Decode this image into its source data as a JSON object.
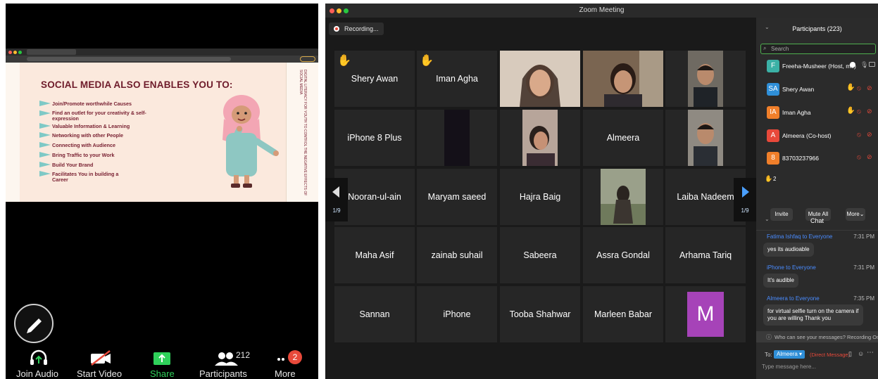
{
  "phone": {
    "slide": {
      "title": "SOCIAL MEDIA ALSO ENABLES YOU TO:",
      "items": [
        "Join/Promote worthwhile Causes",
        "Find an outlet for your creativity & self-expression",
        "Valuable Information & Learning",
        "Networking with other People",
        "Connecting with Audience",
        "Bring Traffic to your Work",
        "Build Your Brand",
        "Facilitates You in building a Career"
      ],
      "side_text": "DIGITAL LITERACY FOR YOUTH TO CONTROL THE NEGATIVE EFFECTS OF SOCIAL MEDIA"
    },
    "toolbar": {
      "join_audio": "Join Audio",
      "start_video": "Start Video",
      "share": "Share",
      "participants": "Participants",
      "participants_count": "212",
      "more": "More",
      "more_badge": "2"
    }
  },
  "zoom": {
    "window_title": "Zoom Meeting",
    "recording": "Recording...",
    "page_indicator": "1/9",
    "grid": [
      [
        "Shery Awan",
        "Iman Agha",
        "",
        "",
        ""
      ],
      [
        "iPhone 8 Plus",
        "",
        "",
        "Almeera",
        ""
      ],
      [
        "Nooran-ul-ain",
        "Maryam saeed",
        "Hajra Baig",
        "",
        "Laiba Nadeem"
      ],
      [
        "Maha Asif",
        "zainab suhail",
        "Sabeera",
        "Assra Gondal",
        "Arhama Tariq"
      ],
      [
        "Sannan",
        "iPhone",
        "Tooba Shahwar",
        "Marleen Babar",
        "M"
      ]
    ],
    "participants_panel": {
      "header": "Participants (223)",
      "search_placeholder": "Search",
      "participants": [
        {
          "initials": "F",
          "name": "Freeha-Musheer (Host, me)",
          "color": "#3bb1a6"
        },
        {
          "initials": "SA",
          "name": "Shery Awan",
          "color": "#2f8fd8"
        },
        {
          "initials": "IA",
          "name": "Iman Agha",
          "color": "#f07f2a"
        },
        {
          "initials": "A",
          "name": "Almeera (Co-host)",
          "color": "#e8493a"
        },
        {
          "initials": "8",
          "name": "83703237966",
          "color": "#f07f2a"
        }
      ],
      "raised_hands": "2",
      "invite": "Invite",
      "mute_all": "Mute All",
      "more": "More"
    },
    "chat": {
      "header": "Chat",
      "messages": [
        {
          "from": "Fatima Ishfaq to Everyone",
          "time": "7:31 PM",
          "text": "yes its audioable"
        },
        {
          "from": "iPhone to Everyone",
          "time": "7:31 PM",
          "text": "It's audible"
        },
        {
          "from": "Almeera to Everyone",
          "time": "7:35 PM",
          "text": "for virtual selfie turn on the camera if you are willing Thank you"
        }
      ],
      "privacy_note": "Who can see your messages? Recording On",
      "to_label": "To:",
      "to_recipient": "Almeera",
      "direct_message": "(Direct Message)",
      "input_placeholder": "Type message here..."
    }
  }
}
